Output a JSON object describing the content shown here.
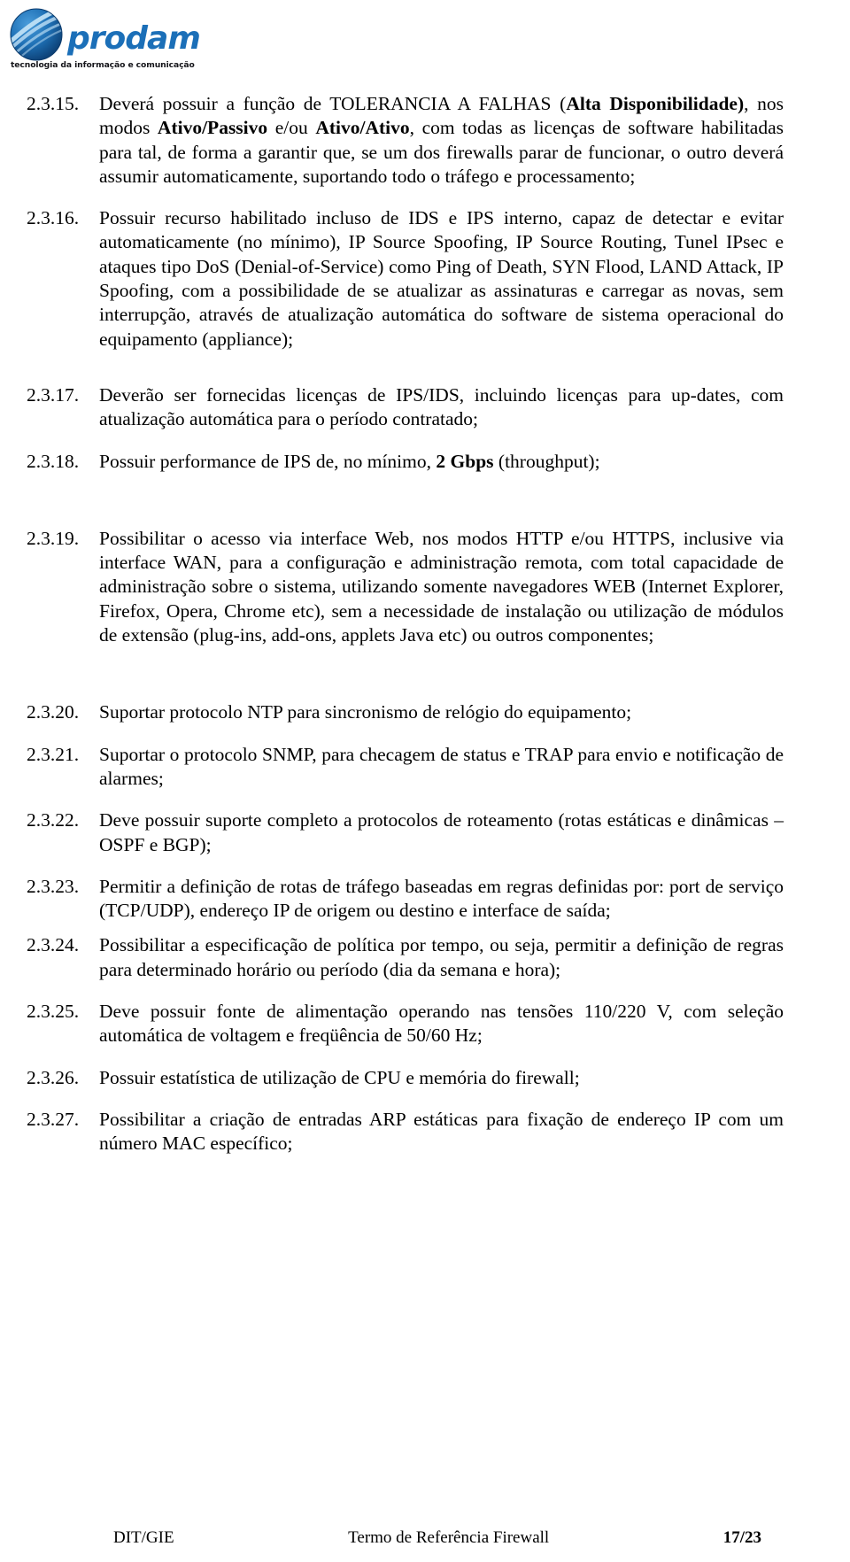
{
  "header": {
    "logo_word": "prodam",
    "logo_tagline": "tecnologia da informação e comunicação",
    "logo_icon": "prodam-globe-swoosh-icon",
    "brand_color": "#1b6fb8"
  },
  "document": {
    "clauses": [
      {
        "number": "2.3.15.",
        "text_segments": [
          {
            "text": "Deverá possuir a função de TOLERANCIA A FALHAS (",
            "bold": false
          },
          {
            "text": "Alta Disponibilidade)",
            "bold": true
          },
          {
            "text": ", nos modos ",
            "bold": false
          },
          {
            "text": "Ativo/Passivo",
            "bold": true
          },
          {
            "text": " e/ou ",
            "bold": false
          },
          {
            "text": "Ativo/Ativo",
            "bold": true
          },
          {
            "text": ", com todas as licenças de software habilitadas para tal, de forma a garantir que, se um dos firewalls parar de funcionar, o outro deverá assumir automaticamente, suportando todo o tráfego e processamento;",
            "bold": false
          }
        ]
      },
      {
        "number": "2.3.16.",
        "text_segments": [
          {
            "text": "Possuir recurso habilitado incluso de IDS e IPS interno, capaz de detectar e evitar automaticamente (no mínimo), IP Source Spoofing, IP Source Routing, Tunel IPsec e ataques tipo DoS (Denial-of-Service) como Ping of Death, SYN Flood, LAND Attack, IP Spoofing, com a possibilidade de se atualizar as assinaturas e carregar as novas, sem interrupção, através de atualização automática  do software de sistema operacional do equipamento (appliance);",
            "bold": false
          }
        ]
      },
      {
        "number": "2.3.17.",
        "text_segments": [
          {
            "text": "Deverão ser fornecidas licenças de IPS/IDS, incluindo licenças para up-dates, com atualização automática para o período contratado;",
            "bold": false
          }
        ]
      },
      {
        "number": "2.3.18.",
        "text_segments": [
          {
            "text": "Possuir performance de IPS de, no mínimo, ",
            "bold": false
          },
          {
            "text": "2 Gbps",
            "bold": true
          },
          {
            "text": " (throughput);",
            "bold": false
          }
        ]
      },
      {
        "number": "2.3.19.",
        "text_segments": [
          {
            "text": " Possibilitar o acesso via interface Web, nos modos HTTP e/ou HTTPS, inclusive via interface WAN, para a configuração e administração remota, com total capacidade de administração sobre o sistema, utilizando somente navegadores WEB (Internet Explorer, Firefox, Opera, Chrome etc), sem a necessidade de instalação ou utilização de módulos de extensão (plug-ins, add-ons, applets Java etc) ou outros componentes;",
            "bold": false
          }
        ]
      },
      {
        "number": "2.3.20.",
        "text_segments": [
          {
            "text": "Suportar protocolo NTP para sincronismo de relógio do equipamento;",
            "bold": false
          }
        ]
      },
      {
        "number": "2.3.21.",
        "text_segments": [
          {
            "text": "Suportar o protocolo SNMP, para checagem de status e TRAP para envio e notificação de alarmes;",
            "bold": false
          }
        ]
      },
      {
        "number": "2.3.22.",
        "text_segments": [
          {
            "text": "Deve possuir suporte completo a protocolos de roteamento (rotas estáticas e dinâmicas – OSPF e BGP);",
            "bold": false
          }
        ]
      },
      {
        "number": "2.3.23.",
        "text_segments": [
          {
            "text": "Permitir a definição de rotas de tráfego baseadas em regras definidas por: port de serviço (TCP/UDP), endereço IP de origem ou destino e interface de saída;",
            "bold": false
          }
        ]
      },
      {
        "number": "2.3.24.",
        "text_segments": [
          {
            "text": "Possibilitar a especificação de política por tempo, ou seja, permitir a definição de regras para determinado horário ou período (dia da semana e hora);",
            "bold": false
          }
        ]
      },
      {
        "number": "2.3.25.",
        "text_segments": [
          {
            "text": "Deve possuir fonte de alimentação operando nas tensões 110/220 V, com seleção automática de voltagem e freqüência de 50/60 Hz;",
            "bold": false
          }
        ]
      },
      {
        "number": "2.3.26.",
        "text_segments": [
          {
            "text": "Possuir estatística de utilização de CPU e memória do firewall;",
            "bold": false
          }
        ]
      },
      {
        "number": "2.3.27.",
        "text_segments": [
          {
            "text": "Possibilitar a criação de entradas ARP estáticas para fixação de endereço IP com um número MAC específico;",
            "bold": false
          }
        ]
      }
    ]
  },
  "footer": {
    "left": "DIT/GIE",
    "center": "Termo de Referência Firewall",
    "right": "17/23"
  }
}
